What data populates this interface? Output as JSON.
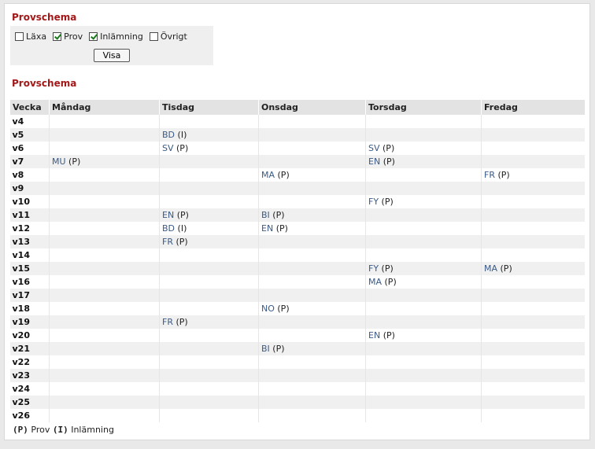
{
  "filter": {
    "title": "Provschema",
    "checkboxes": [
      {
        "label": "Läxa",
        "checked": false
      },
      {
        "label": "Prov",
        "checked": true
      },
      {
        "label": "Inlämning",
        "checked": true
      },
      {
        "label": "Övrigt",
        "checked": false
      }
    ],
    "button_label": "Visa"
  },
  "schedule": {
    "title": "Provschema",
    "headers": [
      "Vecka",
      "Måndag",
      "Tisdag",
      "Onsdag",
      "Torsdag",
      "Fredag"
    ],
    "rows": [
      {
        "week": "v4",
        "days": [
          [],
          [],
          [],
          [],
          []
        ]
      },
      {
        "week": "v5",
        "days": [
          [],
          [
            [
              "BD",
              "(I)"
            ]
          ],
          [],
          [],
          []
        ]
      },
      {
        "week": "v6",
        "days": [
          [],
          [
            [
              "SV",
              "(P)"
            ]
          ],
          [],
          [
            [
              "SV",
              "(P)"
            ]
          ],
          []
        ]
      },
      {
        "week": "v7",
        "days": [
          [
            [
              "MU",
              "(P)"
            ]
          ],
          [],
          [],
          [
            [
              "EN",
              "(P)"
            ]
          ],
          []
        ]
      },
      {
        "week": "v8",
        "days": [
          [],
          [],
          [
            [
              "MA",
              "(P)"
            ]
          ],
          [],
          [
            [
              "FR",
              "(P)"
            ]
          ]
        ]
      },
      {
        "week": "v9",
        "days": [
          [],
          [],
          [],
          [],
          []
        ]
      },
      {
        "week": "v10",
        "days": [
          [],
          [],
          [],
          [
            [
              "FY",
              "(P)"
            ]
          ],
          []
        ]
      },
      {
        "week": "v11",
        "days": [
          [],
          [
            [
              "EN",
              "(P)"
            ]
          ],
          [
            [
              "BI",
              "(P)"
            ]
          ],
          [],
          []
        ]
      },
      {
        "week": "v12",
        "days": [
          [],
          [
            [
              "BD",
              "(I)"
            ]
          ],
          [
            [
              "EN",
              "(P)"
            ]
          ],
          [],
          []
        ]
      },
      {
        "week": "v13",
        "days": [
          [],
          [
            [
              "FR",
              "(P)"
            ]
          ],
          [],
          [],
          []
        ]
      },
      {
        "week": "v14",
        "days": [
          [],
          [],
          [],
          [],
          []
        ]
      },
      {
        "week": "v15",
        "days": [
          [],
          [],
          [],
          [
            [
              "FY",
              "(P)"
            ]
          ],
          [
            [
              "MA",
              "(P)"
            ]
          ]
        ]
      },
      {
        "week": "v16",
        "days": [
          [],
          [],
          [],
          [
            [
              "MA",
              "(P)"
            ]
          ],
          []
        ]
      },
      {
        "week": "v17",
        "days": [
          [],
          [],
          [],
          [],
          []
        ]
      },
      {
        "week": "v18",
        "days": [
          [],
          [],
          [
            [
              "NO",
              "(P)"
            ]
          ],
          [],
          []
        ]
      },
      {
        "week": "v19",
        "days": [
          [],
          [
            [
              "FR",
              "(P)"
            ]
          ],
          [],
          [],
          []
        ]
      },
      {
        "week": "v20",
        "days": [
          [],
          [],
          [],
          [
            [
              "EN",
              "(P)"
            ]
          ],
          []
        ]
      },
      {
        "week": "v21",
        "days": [
          [],
          [],
          [
            [
              "BI",
              "(P)"
            ]
          ],
          [],
          []
        ]
      },
      {
        "week": "v22",
        "days": [
          [],
          [],
          [],
          [],
          []
        ]
      },
      {
        "week": "v23",
        "days": [
          [],
          [],
          [],
          [],
          []
        ]
      },
      {
        "week": "v24",
        "days": [
          [],
          [],
          [],
          [],
          []
        ]
      },
      {
        "week": "v25",
        "days": [
          [],
          [],
          [],
          [],
          []
        ]
      },
      {
        "week": "v26",
        "days": [
          [],
          [],
          [],
          [],
          []
        ]
      }
    ]
  },
  "legend": {
    "p_code": "(P)",
    "p_label": "Prov",
    "i_code": "(I)",
    "i_label": "Inlämning"
  }
}
